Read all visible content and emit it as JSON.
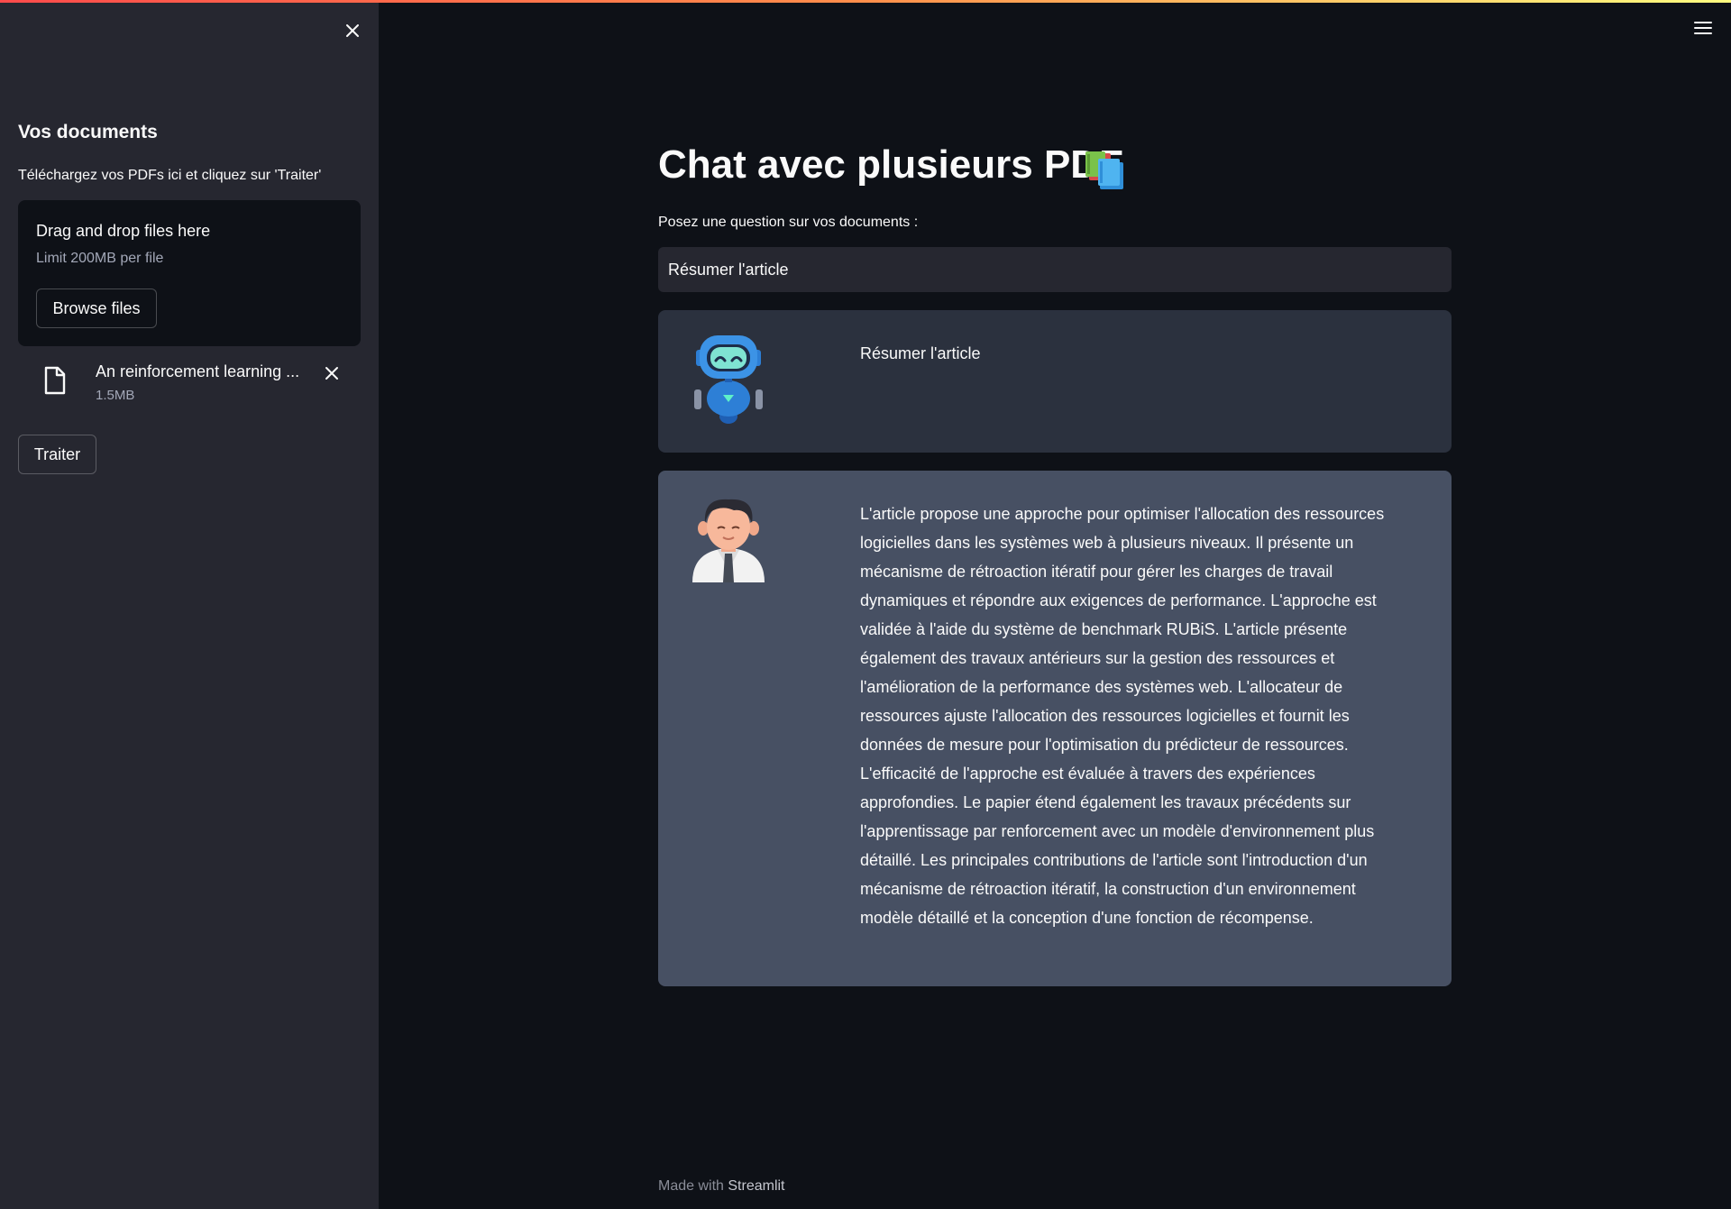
{
  "sidebar": {
    "title": "Vos documents",
    "description": "Téléchargez vos PDFs ici et cliquez sur 'Traiter'",
    "close_icon": "close-icon",
    "uploader": {
      "title": "Drag and drop files here",
      "limit": "Limit 200MB per file",
      "browse_label": "Browse files"
    },
    "file": {
      "name": "An reinforcement learning ...",
      "size": "1.5MB",
      "icon": "file-icon",
      "remove_icon": "close-icon"
    },
    "process_label": "Traiter"
  },
  "header": {
    "menu_icon": "hamburger-menu-icon",
    "accent_gradient": [
      "#ff4b4b",
      "#ff8f4b",
      "#fffd80"
    ]
  },
  "main": {
    "title": "Chat avec plusieurs PDF",
    "title_icon": "books-icon",
    "question_label": "Posez une question sur vos documents :",
    "question_value": "Résumer l'article",
    "messages": [
      {
        "avatar": "robot-avatar-icon",
        "text": "Résumer l'article"
      },
      {
        "avatar": "person-avatar-icon",
        "text": "L'article propose une approche pour optimiser l'allocation des ressources logicielles dans les systèmes web à plusieurs niveaux. Il présente un mécanisme de rétroaction itératif pour gérer les charges de travail dynamiques et répondre aux exigences de performance. L'approche est validée à l'aide du système de benchmark RUBiS. L'article présente également des travaux antérieurs sur la gestion des ressources et l'amélioration de la performance des systèmes web. L'allocateur de ressources ajuste l'allocation des ressources logicielles et fournit les données de mesure pour l'optimisation du prédicteur de ressources. L'efficacité de l'approche est évaluée à travers des expériences approfondies. Le papier étend également les travaux précédents sur l'apprentissage par renforcement avec un modèle d'environnement plus détaillé. Les principales contributions de l'article sont l'introduction d'un mécanisme de rétroaction itératif, la construction d'un environnement modèle détaillé et la conception d'une fonction de récompense."
      }
    ]
  },
  "footer": {
    "prefix": "Made with",
    "brand": "Streamlit"
  },
  "colors": {
    "background": "#0e1117",
    "sidebar": "#262730",
    "bot_message": "#2b313e",
    "user_message": "#475063"
  }
}
